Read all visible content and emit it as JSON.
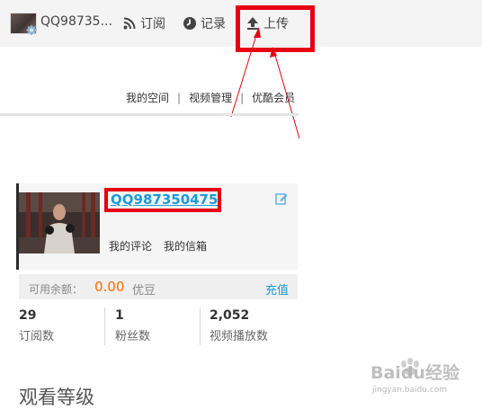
{
  "topbar": {
    "username": "QQ98735...",
    "subscribe_label": "订阅",
    "history_label": "记录",
    "upload_label": "上传"
  },
  "sublinks": {
    "my_space": "我的空间",
    "sep": "|",
    "video_manage": "视频管理",
    "youku_member": "优酷会员"
  },
  "profile": {
    "name": "QQ987350475",
    "my_comments": "我的评论",
    "my_inbox": "我的信箱"
  },
  "balance": {
    "label": "可用余额：",
    "amount": "0.00",
    "unit": "优豆",
    "recharge": "充值"
  },
  "stats": [
    {
      "value": "29",
      "label": "订阅数"
    },
    {
      "value": "1",
      "label": "粉丝数"
    },
    {
      "value": "2,052",
      "label": "视频播放数"
    }
  ],
  "level_title": "观看等级",
  "watermark": {
    "brand": "Baidu经验",
    "url": "jingyan.baidu.com"
  },
  "colors": {
    "accent_blue": "#1a9bd7",
    "highlight_red": "#e60012",
    "amount_orange": "#ff6a00"
  }
}
